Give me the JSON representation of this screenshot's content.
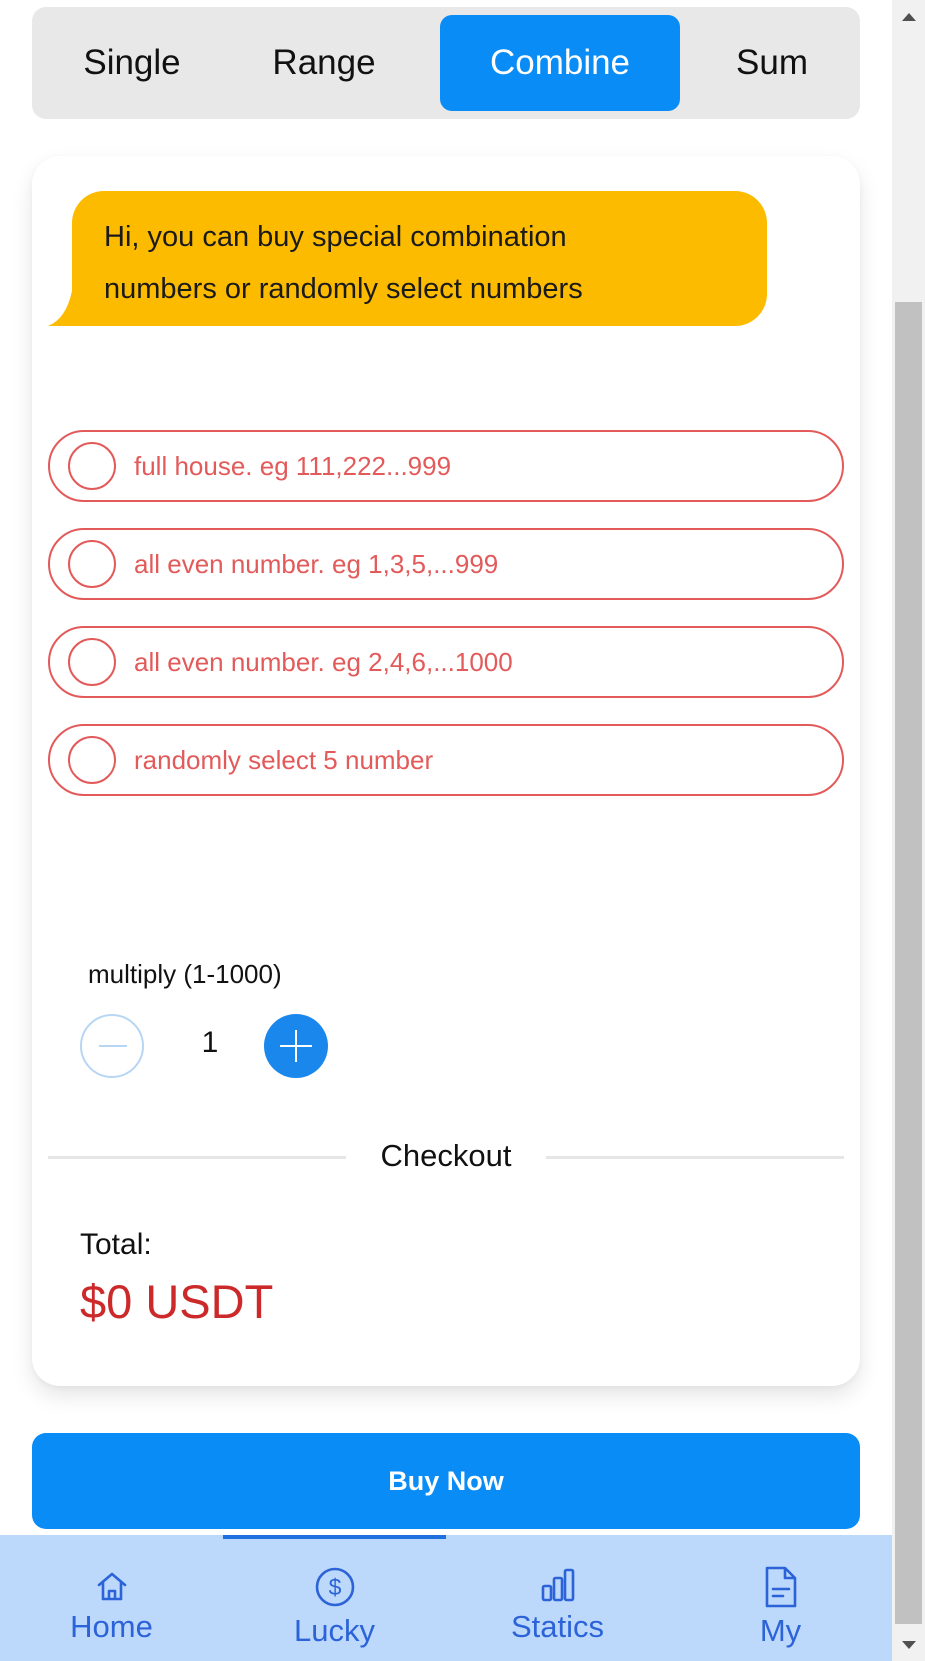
{
  "tabs": [
    {
      "label": "Single",
      "active": false
    },
    {
      "label": "Range",
      "active": false
    },
    {
      "label": "Combine",
      "active": true
    },
    {
      "label": "Sum",
      "active": false
    }
  ],
  "bubble": {
    "line1": "Hi, you can buy special combination",
    "line2": "numbers or randomly select numbers"
  },
  "options": [
    {
      "label": "full house. eg 111,222...999",
      "selected": false
    },
    {
      "label": "all even number. eg 1,3,5,...999",
      "selected": false
    },
    {
      "label": "all even number. eg 2,4,6,...1000",
      "selected": false
    },
    {
      "label": "randomly select 5 number",
      "selected": false
    }
  ],
  "multiply": {
    "label": "multiply (1-1000)",
    "value": "1"
  },
  "checkout": {
    "title": "Checkout",
    "total_label": "Total:",
    "total_value": "$0 USDT"
  },
  "buy_button": {
    "label": "Buy Now"
  },
  "bottom_nav": [
    {
      "label": "Home",
      "icon": "home-icon",
      "active": false
    },
    {
      "label": "Lucky",
      "icon": "dollar-circle-icon",
      "active": true
    },
    {
      "label": "Statics",
      "icon": "bar-chart-icon",
      "active": false
    },
    {
      "label": "My",
      "icon": "document-icon",
      "active": false
    }
  ],
  "colors": {
    "accent": "#0a8cf6",
    "bubble": "#fdbb00",
    "option": "#e35a5a",
    "total": "#cc2a2a",
    "nav_bg": "#bcd8fb",
    "nav_fg": "#2c63d8"
  }
}
